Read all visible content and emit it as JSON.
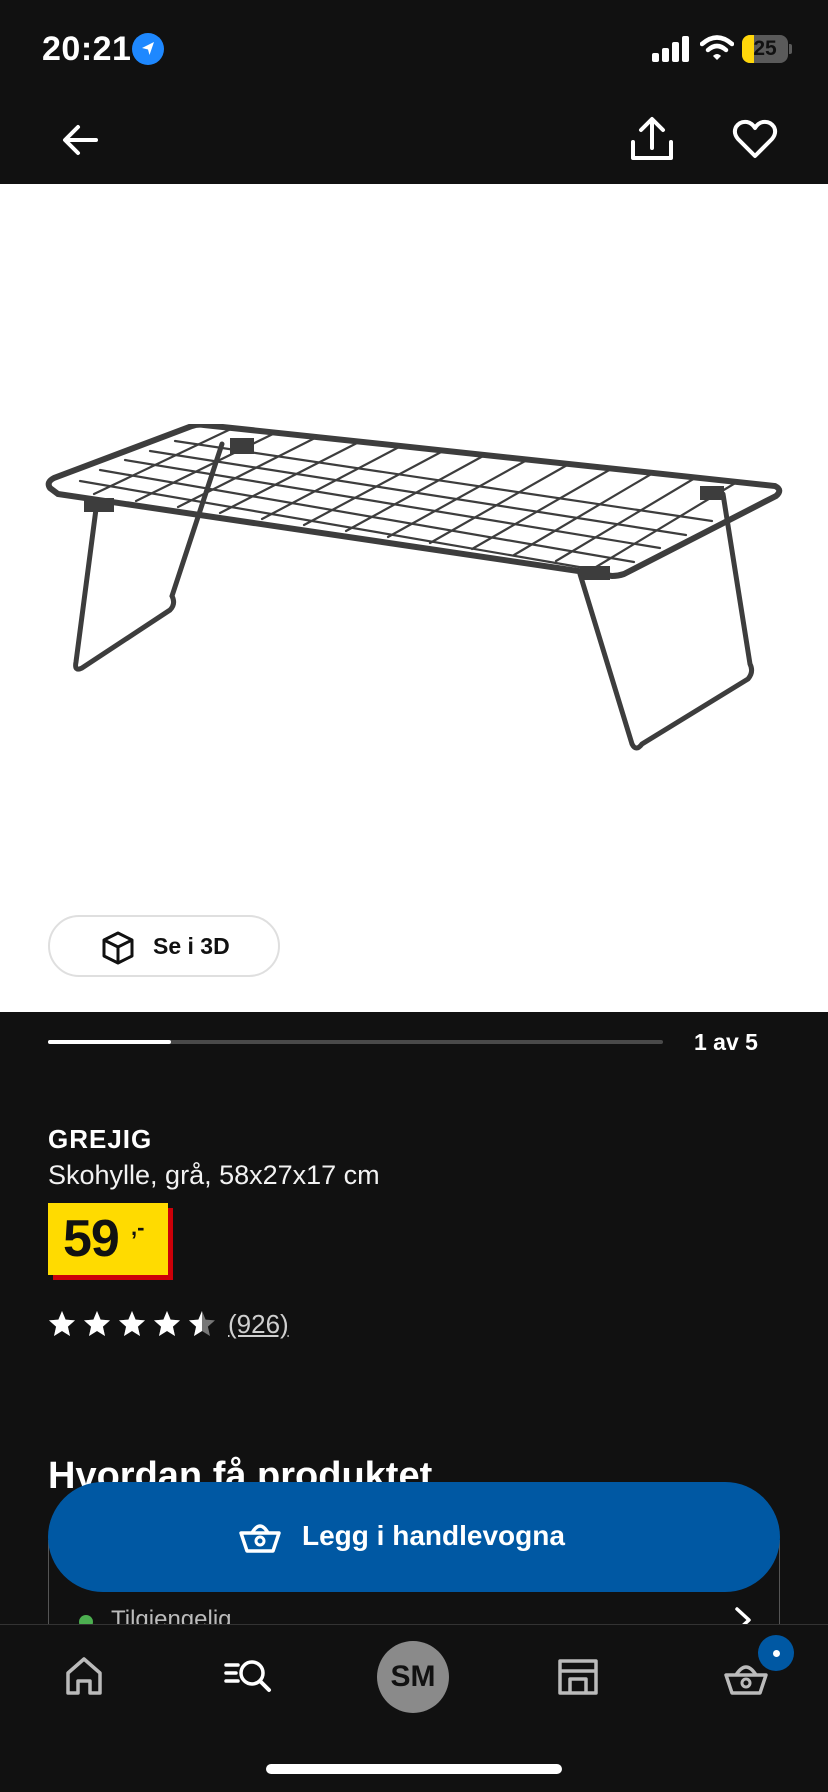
{
  "status_bar": {
    "time": "20:21",
    "battery_level": "25",
    "battery_fraction": 0.25
  },
  "header": {
    "back_icon": "arrow-left-icon",
    "share_icon": "share-icon",
    "favorite_icon": "heart-icon"
  },
  "gallery": {
    "view_3d_label": "Se i 3D",
    "page_counter": "1 av 5",
    "progress_fraction": 0.2
  },
  "product": {
    "name": "GREJIG",
    "description": "Skohylle, grå, 58x27x17 cm",
    "price": "59",
    "price_suffix": ",-",
    "rating": 4.5,
    "review_count": "(926)"
  },
  "delivery": {
    "heading": "Hvordan få produktet",
    "availability": "Tilgjengelig"
  },
  "cart_button": {
    "label": "Legg i handlevogna"
  },
  "bottom_nav": {
    "profile_initials": "SM",
    "items": [
      "home-icon",
      "search-icon",
      "profile-avatar",
      "store-icon",
      "cart-icon"
    ]
  },
  "colors": {
    "background": "#111111",
    "price_yellow": "#ffdb00",
    "price_red": "#cc0008",
    "ikea_blue": "#0058a3",
    "available_green": "#4caf50"
  }
}
